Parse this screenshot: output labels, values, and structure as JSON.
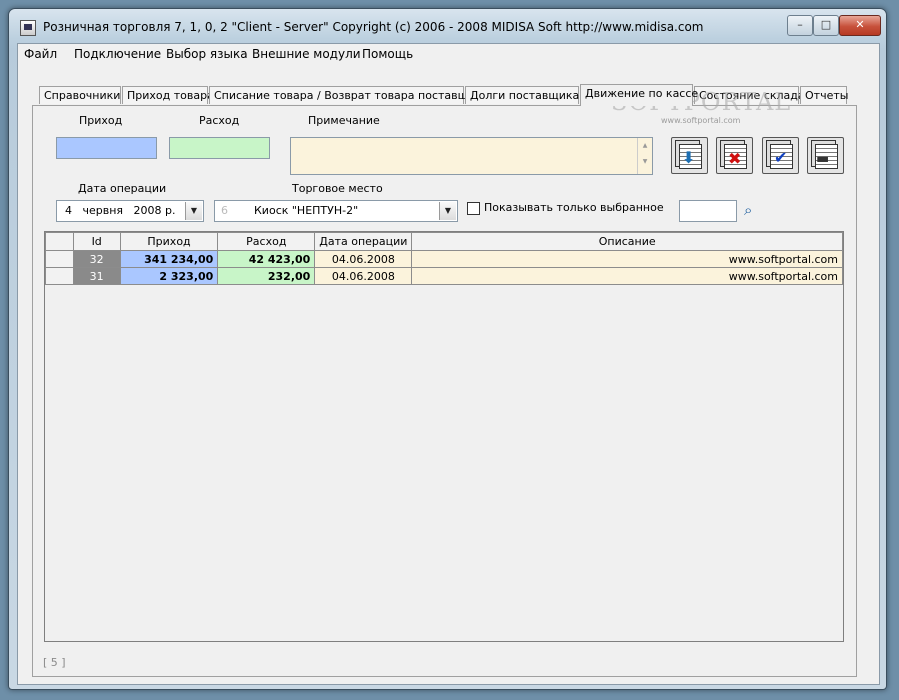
{
  "window": {
    "title": "Розничная торговля 7, 1, 0, 2 \"Client - Server\" Copyright (c) 2006 - 2008 MIDISA Soft http://www.midisa.com",
    "minimize": "–",
    "maximize": "□",
    "close": "✕"
  },
  "menu": [
    "Файл",
    "Подключение",
    "Выбор языка",
    "Внешние модули",
    "Помощь"
  ],
  "tabs": [
    "Справочники",
    "Приход товара",
    "Списание товара / Возврат товара поставщику",
    "Долги поставщикам",
    "Движение по кассе",
    "Состояние склада",
    "Отчеты"
  ],
  "active_tab": "Движение по кассе",
  "form": {
    "income_label": "Приход",
    "income_value": "",
    "expense_label": "Расход",
    "expense_value": "",
    "note_label": "Примечание",
    "note_value": "",
    "date_label": "Дата операции",
    "date_value": "4   червня   2008 р.",
    "place_label": "Торговое место",
    "place_code": "6",
    "place_value": "Киоск \"НЕПТУН-2\"",
    "show_selected_label": "Показывать только выбранное",
    "show_selected_checked": false,
    "search_value": ""
  },
  "toolbar": {
    "buttons": [
      {
        "name": "save-record",
        "icon": "down-arrow-icon"
      },
      {
        "name": "delete-record",
        "icon": "red-x-icon"
      },
      {
        "name": "approve-record",
        "icon": "check-icon"
      },
      {
        "name": "print-record",
        "icon": "printer-icon"
      }
    ]
  },
  "watermark": {
    "text": "SOFTPORTAL",
    "sub": "www.softportal.com"
  },
  "grid": {
    "columns": [
      "Id",
      "Приход",
      "Расход",
      "Дата операции",
      "Описание"
    ],
    "rows": [
      {
        "id": "32",
        "income": "341 234,00",
        "expense": "42 423,00",
        "date": "04.06.2008",
        "description": "www.softportal.com"
      },
      {
        "id": "31",
        "income": "2 323,00",
        "expense": "232,00",
        "date": "04.06.2008",
        "description": "www.softportal.com"
      }
    ]
  },
  "status": "[ 5 ]",
  "colors": {
    "income": "#aac7ff",
    "expense": "#c8f5c8",
    "note": "#fbf3dc"
  }
}
